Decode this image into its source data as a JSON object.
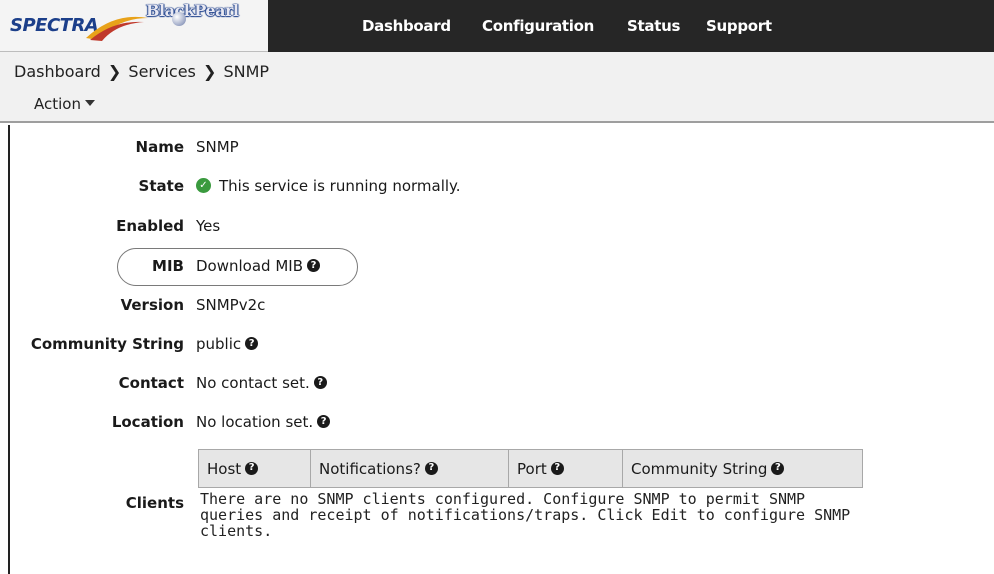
{
  "brand": {
    "name": "SPECTRA",
    "product": "BlackPearl"
  },
  "nav": {
    "items": [
      "Dashboard",
      "Configuration",
      "Status",
      "Support"
    ]
  },
  "breadcrumb": [
    "Dashboard",
    "Services",
    "SNMP"
  ],
  "breadcrumb_separator": "❯",
  "action_menu": {
    "label": "Action"
  },
  "details": {
    "name": {
      "label": "Name",
      "value": "SNMP"
    },
    "state": {
      "label": "State",
      "value": "This service is running normally."
    },
    "enabled": {
      "label": "Enabled",
      "value": "Yes"
    },
    "mib": {
      "label": "MIB",
      "value": "Download MIB"
    },
    "version": {
      "label": "Version",
      "value": "SNMPv2c"
    },
    "community": {
      "label": "Community String",
      "value": "public"
    },
    "contact": {
      "label": "Contact",
      "value": "No contact set."
    },
    "location": {
      "label": "Location",
      "value": "No location set."
    },
    "clients": {
      "label": "Clients",
      "columns": [
        "Host",
        "Notifications?",
        "Port",
        "Community String"
      ],
      "empty_message": "There are no SNMP clients configured. Configure SNMP to permit SNMP queries and receipt of notifications/traps. Click Edit to configure SNMP clients."
    }
  },
  "icons": {
    "help": "question-circle-icon",
    "status_ok": "check-circle-icon",
    "dropdown": "caret-down-icon"
  },
  "colors": {
    "topbar": "#262626",
    "subbar": "#f1f1f1",
    "status_ok": "#3a9a3e",
    "brand_blue": "#1c3f8a"
  }
}
